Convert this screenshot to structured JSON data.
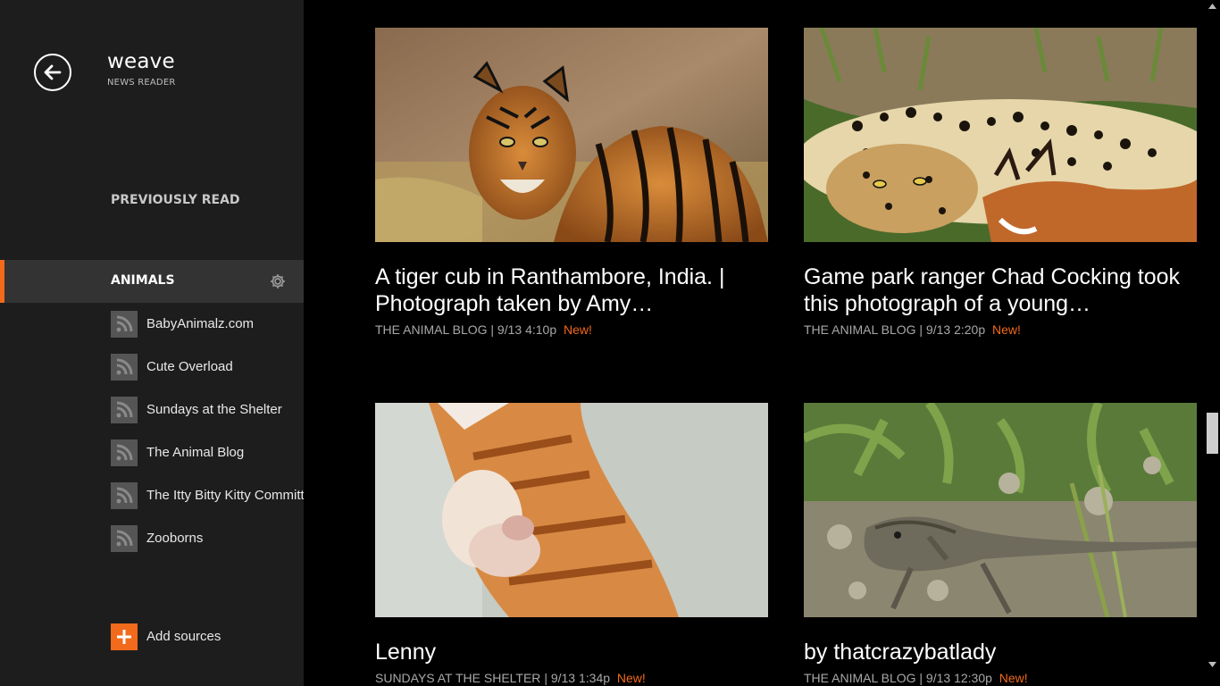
{
  "app": {
    "title": "weave",
    "subtitle": "NEWS READER"
  },
  "sidebar": {
    "previously_read": "PREVIOUSLY READ",
    "category": "ANIMALS",
    "feeds": [
      {
        "label": "BabyAnimalz.com"
      },
      {
        "label": "Cute Overload"
      },
      {
        "label": "Sundays at the Shelter"
      },
      {
        "label": "The Animal Blog"
      },
      {
        "label": "The Itty Bitty Kitty Committ"
      },
      {
        "label": "Zooborns"
      }
    ],
    "add_sources": "Add sources"
  },
  "articles": [
    {
      "title": "A tiger cub in Ranthambore, India. | Photograph taken by Amy…",
      "source": "THE ANIMAL BLOG",
      "date": "| 9/13 4:10p",
      "badge": "New!"
    },
    {
      "title": "Game park ranger Chad Cocking took this photograph of a young…",
      "source": "THE ANIMAL BLOG",
      "date": "| 9/13 2:20p",
      "badge": "New!"
    },
    {
      "title": "Lenny",
      "source": "SUNDAYS AT THE SHELTER",
      "date": "| 9/13 1:34p",
      "badge": "New!"
    },
    {
      "title": "by thatcrazybatlady",
      "source": "THE ANIMAL BLOG",
      "date": "| 9/13 12:30p",
      "badge": "New!"
    }
  ],
  "colors": {
    "accent": "#f26a1b",
    "sidebar_bg": "#1d1d1d",
    "selected_bg": "#333333",
    "main_bg": "#000000"
  }
}
